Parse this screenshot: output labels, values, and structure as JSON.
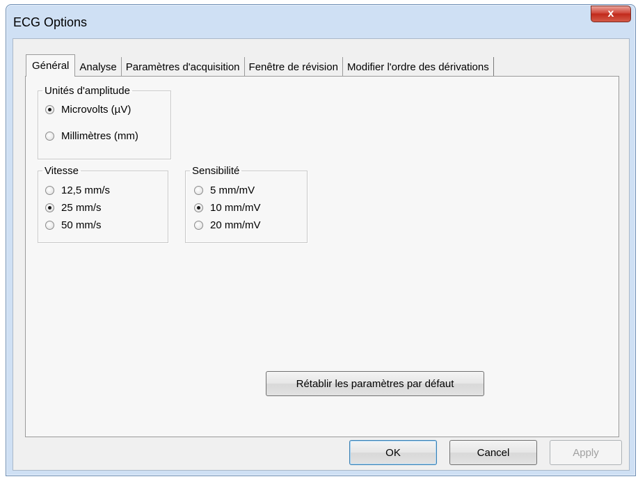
{
  "window": {
    "title": "ECG Options",
    "close_label": "x"
  },
  "tabs": [
    {
      "label": "Général",
      "active": true
    },
    {
      "label": "Analyse",
      "active": false
    },
    {
      "label": "Paramètres d'acquisition",
      "active": false
    },
    {
      "label": "Fenêtre de révision",
      "active": false
    },
    {
      "label": "Modifier l'ordre des dérivations",
      "active": false
    }
  ],
  "amplitude": {
    "legend": "Unités d'amplitude",
    "options": [
      {
        "label": "Microvolts (µV)",
        "checked": true
      },
      {
        "label": "Millimètres (mm)",
        "checked": false
      }
    ]
  },
  "vitesse": {
    "legend": "Vitesse",
    "options": [
      {
        "label": "12,5 mm/s",
        "checked": false
      },
      {
        "label": "25 mm/s",
        "checked": true
      },
      {
        "label": "50 mm/s",
        "checked": false
      }
    ]
  },
  "sensibilite": {
    "legend": "Sensibilité",
    "options": [
      {
        "label": "5 mm/mV",
        "checked": false
      },
      {
        "label": "10 mm/mV",
        "checked": true
      },
      {
        "label": "20 mm/mV",
        "checked": false
      }
    ]
  },
  "reset_button": "Rétablir les paramètres par défaut",
  "buttons": {
    "ok": "OK",
    "cancel": "Cancel",
    "apply": "Apply"
  }
}
